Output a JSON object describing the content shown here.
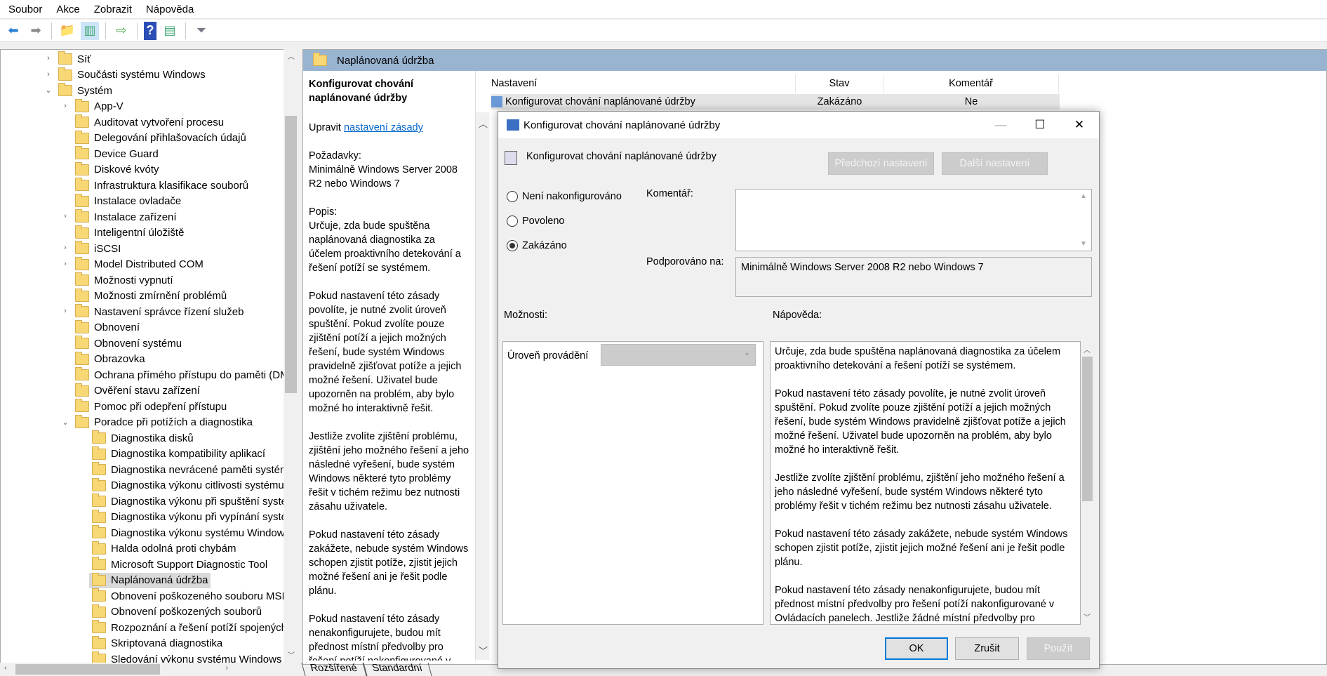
{
  "menu": [
    "Soubor",
    "Akce",
    "Zobrazit",
    "Nápověda"
  ],
  "tree": [
    {
      "label": "Síť",
      "level": 0,
      "expander": "collapsed"
    },
    {
      "label": "Součásti systému Windows",
      "level": 0,
      "expander": "collapsed"
    },
    {
      "label": "Systém",
      "level": 0,
      "expander": "expanded"
    },
    {
      "label": "App-V",
      "level": 1,
      "expander": "collapsed"
    },
    {
      "label": "Auditovat vytvoření procesu",
      "level": 1
    },
    {
      "label": "Delegování přihlašovacích údajů",
      "level": 1
    },
    {
      "label": "Device Guard",
      "level": 1
    },
    {
      "label": "Diskové kvóty",
      "level": 1
    },
    {
      "label": "Infrastruktura klasifikace souborů",
      "level": 1
    },
    {
      "label": "Instalace ovladače",
      "level": 1
    },
    {
      "label": "Instalace zařízení",
      "level": 1,
      "expander": "collapsed"
    },
    {
      "label": "Inteligentní úložiště",
      "level": 1
    },
    {
      "label": "iSCSI",
      "level": 1,
      "expander": "collapsed"
    },
    {
      "label": "Model Distributed COM",
      "level": 1,
      "expander": "collapsed"
    },
    {
      "label": "Možnosti vypnutí",
      "level": 1
    },
    {
      "label": "Možnosti zmírnění problémů",
      "level": 1
    },
    {
      "label": "Nastavení správce řízení služeb",
      "level": 1,
      "expander": "collapsed"
    },
    {
      "label": "Obnovení",
      "level": 1
    },
    {
      "label": "Obnovení systému",
      "level": 1
    },
    {
      "label": "Obrazovka",
      "level": 1
    },
    {
      "label": "Ochrana přímého přístupu do paměti (DMA)",
      "level": 1
    },
    {
      "label": "Ověření stavu zařízení",
      "level": 1
    },
    {
      "label": "Pomoc při odepření přístupu",
      "level": 1
    },
    {
      "label": "Poradce při potížích a diagnostika",
      "level": 1,
      "expander": "expanded"
    },
    {
      "label": "Diagnostika disků",
      "level": 2
    },
    {
      "label": "Diagnostika kompatibility aplikací",
      "level": 2
    },
    {
      "label": "Diagnostika nevrácené paměti systému",
      "level": 2
    },
    {
      "label": "Diagnostika výkonu citlivosti systému",
      "level": 2
    },
    {
      "label": "Diagnostika výkonu při spuštění systému",
      "level": 2
    },
    {
      "label": "Diagnostika výkonu při vypínání systému",
      "level": 2
    },
    {
      "label": "Diagnostika výkonu systému Windows",
      "level": 2
    },
    {
      "label": "Halda odolná proti chybám",
      "level": 2
    },
    {
      "label": "Microsoft Support Diagnostic Tool",
      "level": 2
    },
    {
      "label": "Naplánovaná údržba",
      "level": 2,
      "selected": true
    },
    {
      "label": "Obnovení poškozeného souboru MSI",
      "level": 2
    },
    {
      "label": "Obnovení poškozených souborů",
      "level": 2
    },
    {
      "label": "Rozpoznání a řešení potíží spojených s",
      "level": 2
    },
    {
      "label": "Skriptovaná diagnostika",
      "level": 2
    },
    {
      "label": "Sledování výkonu systému Windows",
      "level": 2
    }
  ],
  "right": {
    "header": "Naplánovaná údržba",
    "desc": {
      "title": "Konfigurovat chování naplánované údržby",
      "edit_prefix": "Upravit ",
      "edit_link": "nastavení zásady",
      "req_label": "Požadavky:",
      "req": "Minimálně Windows Server 2008 R2 nebo Windows 7",
      "desc_label": "Popis:",
      "paras": [
        "Určuje, zda bude spuštěna naplánovaná diagnostika za účelem proaktivního detekování a řešení potíží se systémem.",
        "Pokud nastavení této zásady povolíte, je nutné zvolit úroveň spuštění. Pokud zvolíte pouze zjištění potíží a jejich možných řešení, bude systém Windows pravidelně zjišťovat potíže a jejich možné řešení. Uživatel bude upozorněn na problém, aby bylo možné ho interaktivně řešit.",
        "Jestliže zvolíte zjištění problému, zjištění jeho možného řešení a jeho následné vyřešení, bude systém Windows některé tyto problémy řešit v tichém režimu bez nutnosti zásahu uživatele.",
        "Pokud nastavení této zásady zakážete, nebude systém Windows schopen zjistit potíže, zjistit jejich možné řešení ani je řešit podle plánu.",
        "Pokud nastavení této zásady nenakonfigurujete, budou mít přednost místní předvolby pro řešení potíží nakonfigurované v Ovládacích panelech. Jestliže žádné místní předvolby pro"
      ]
    },
    "columns": [
      "Nastavení",
      "Stav",
      "Komentář"
    ],
    "row": {
      "name": "Konfigurovat chování naplánované údržby",
      "state": "Zakázáno",
      "comment": "Ne"
    },
    "tabs": [
      "Rozšířené",
      "Standardní"
    ]
  },
  "dialog": {
    "title": "Konfigurovat chování naplánované údržby",
    "heading": "Konfigurovat chování naplánované údržby",
    "prev": "Předchozí nastavení",
    "next": "Další nastavení",
    "radios": [
      "Není nakonfigurováno",
      "Povoleno",
      "Zakázáno"
    ],
    "selected_radio": "Zakázáno",
    "comment_label": "Komentář:",
    "comment_value": "",
    "supported_label": "Podporováno na:",
    "supported_value": "Minimálně Windows Server 2008 R2 nebo Windows 7",
    "options_label": "Možnosti:",
    "help_label": "Nápověda:",
    "level_label": "Úroveň provádění",
    "level_value": "",
    "help": [
      "Určuje, zda bude spuštěna naplánovaná diagnostika za účelem proaktivního detekování a řešení potíží se systémem.",
      "Pokud nastavení této zásady povolíte, je nutné zvolit úroveň spuštění. Pokud zvolíte pouze zjištění potíží a jejich možných řešení, bude systém Windows pravidelně zjišťovat potíže a jejich možné řešení. Uživatel bude upozorněn na problém, aby bylo možné ho interaktivně řešit.",
      "Jestliže zvolíte zjištění problému, zjištění jeho možného řešení a jeho následné vyřešení, bude systém Windows některé tyto problémy řešit v tichém režimu bez nutnosti zásahu uživatele.",
      "Pokud nastavení této zásady zakážete, nebude systém Windows schopen zjistit potíže, zjistit jejich možné řešení ani je řešit podle plánu.",
      "Pokud nastavení této zásady nenakonfigurujete, budou mít přednost místní předvolby pro řešení potíží nakonfigurované v Ovládacích panelech. Jestliže žádné místní předvolby pro"
    ],
    "ok": "OK",
    "cancel": "Zrušit",
    "apply": "Použít"
  }
}
